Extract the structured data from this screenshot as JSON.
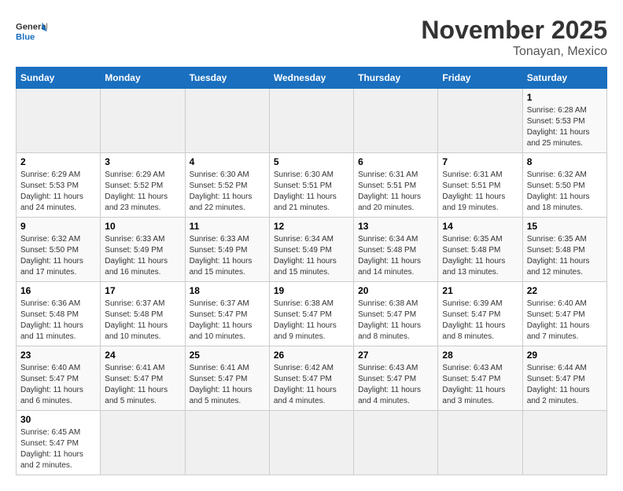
{
  "header": {
    "logo_general": "General",
    "logo_blue": "Blue",
    "month": "November 2025",
    "location": "Tonayan, Mexico"
  },
  "days_of_week": [
    "Sunday",
    "Monday",
    "Tuesday",
    "Wednesday",
    "Thursday",
    "Friday",
    "Saturday"
  ],
  "weeks": [
    [
      {
        "day": "",
        "info": ""
      },
      {
        "day": "",
        "info": ""
      },
      {
        "day": "",
        "info": ""
      },
      {
        "day": "",
        "info": ""
      },
      {
        "day": "",
        "info": ""
      },
      {
        "day": "",
        "info": ""
      },
      {
        "day": "1",
        "info": "Sunrise: 6:28 AM\nSunset: 5:53 PM\nDaylight: 11 hours\nand 25 minutes."
      }
    ],
    [
      {
        "day": "2",
        "info": "Sunrise: 6:29 AM\nSunset: 5:53 PM\nDaylight: 11 hours\nand 24 minutes."
      },
      {
        "day": "3",
        "info": "Sunrise: 6:29 AM\nSunset: 5:52 PM\nDaylight: 11 hours\nand 23 minutes."
      },
      {
        "day": "4",
        "info": "Sunrise: 6:30 AM\nSunset: 5:52 PM\nDaylight: 11 hours\nand 22 minutes."
      },
      {
        "day": "5",
        "info": "Sunrise: 6:30 AM\nSunset: 5:51 PM\nDaylight: 11 hours\nand 21 minutes."
      },
      {
        "day": "6",
        "info": "Sunrise: 6:31 AM\nSunset: 5:51 PM\nDaylight: 11 hours\nand 20 minutes."
      },
      {
        "day": "7",
        "info": "Sunrise: 6:31 AM\nSunset: 5:51 PM\nDaylight: 11 hours\nand 19 minutes."
      },
      {
        "day": "8",
        "info": "Sunrise: 6:32 AM\nSunset: 5:50 PM\nDaylight: 11 hours\nand 18 minutes."
      }
    ],
    [
      {
        "day": "9",
        "info": "Sunrise: 6:32 AM\nSunset: 5:50 PM\nDaylight: 11 hours\nand 17 minutes."
      },
      {
        "day": "10",
        "info": "Sunrise: 6:33 AM\nSunset: 5:49 PM\nDaylight: 11 hours\nand 16 minutes."
      },
      {
        "day": "11",
        "info": "Sunrise: 6:33 AM\nSunset: 5:49 PM\nDaylight: 11 hours\nand 15 minutes."
      },
      {
        "day": "12",
        "info": "Sunrise: 6:34 AM\nSunset: 5:49 PM\nDaylight: 11 hours\nand 15 minutes."
      },
      {
        "day": "13",
        "info": "Sunrise: 6:34 AM\nSunset: 5:48 PM\nDaylight: 11 hours\nand 14 minutes."
      },
      {
        "day": "14",
        "info": "Sunrise: 6:35 AM\nSunset: 5:48 PM\nDaylight: 11 hours\nand 13 minutes."
      },
      {
        "day": "15",
        "info": "Sunrise: 6:35 AM\nSunset: 5:48 PM\nDaylight: 11 hours\nand 12 minutes."
      }
    ],
    [
      {
        "day": "16",
        "info": "Sunrise: 6:36 AM\nSunset: 5:48 PM\nDaylight: 11 hours\nand 11 minutes."
      },
      {
        "day": "17",
        "info": "Sunrise: 6:37 AM\nSunset: 5:48 PM\nDaylight: 11 hours\nand 10 minutes."
      },
      {
        "day": "18",
        "info": "Sunrise: 6:37 AM\nSunset: 5:47 PM\nDaylight: 11 hours\nand 10 minutes."
      },
      {
        "day": "19",
        "info": "Sunrise: 6:38 AM\nSunset: 5:47 PM\nDaylight: 11 hours\nand 9 minutes."
      },
      {
        "day": "20",
        "info": "Sunrise: 6:38 AM\nSunset: 5:47 PM\nDaylight: 11 hours\nand 8 minutes."
      },
      {
        "day": "21",
        "info": "Sunrise: 6:39 AM\nSunset: 5:47 PM\nDaylight: 11 hours\nand 8 minutes."
      },
      {
        "day": "22",
        "info": "Sunrise: 6:40 AM\nSunset: 5:47 PM\nDaylight: 11 hours\nand 7 minutes."
      }
    ],
    [
      {
        "day": "23",
        "info": "Sunrise: 6:40 AM\nSunset: 5:47 PM\nDaylight: 11 hours\nand 6 minutes."
      },
      {
        "day": "24",
        "info": "Sunrise: 6:41 AM\nSunset: 5:47 PM\nDaylight: 11 hours\nand 5 minutes."
      },
      {
        "day": "25",
        "info": "Sunrise: 6:41 AM\nSunset: 5:47 PM\nDaylight: 11 hours\nand 5 minutes."
      },
      {
        "day": "26",
        "info": "Sunrise: 6:42 AM\nSunset: 5:47 PM\nDaylight: 11 hours\nand 4 minutes."
      },
      {
        "day": "27",
        "info": "Sunrise: 6:43 AM\nSunset: 5:47 PM\nDaylight: 11 hours\nand 4 minutes."
      },
      {
        "day": "28",
        "info": "Sunrise: 6:43 AM\nSunset: 5:47 PM\nDaylight: 11 hours\nand 3 minutes."
      },
      {
        "day": "29",
        "info": "Sunrise: 6:44 AM\nSunset: 5:47 PM\nDaylight: 11 hours\nand 2 minutes."
      }
    ],
    [
      {
        "day": "30",
        "info": "Sunrise: 6:45 AM\nSunset: 5:47 PM\nDaylight: 11 hours\nand 2 minutes."
      },
      {
        "day": "",
        "info": ""
      },
      {
        "day": "",
        "info": ""
      },
      {
        "day": "",
        "info": ""
      },
      {
        "day": "",
        "info": ""
      },
      {
        "day": "",
        "info": ""
      },
      {
        "day": "",
        "info": ""
      }
    ]
  ]
}
